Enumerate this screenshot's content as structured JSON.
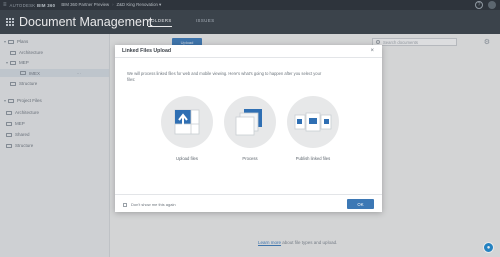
{
  "topbar": {
    "brand_prefix": "AUTODESK",
    "brand_product": "BIM 360",
    "project": "BIM 360 Partner Preview",
    "separator": "›",
    "location": "Z&D King Renovation ▾"
  },
  "header": {
    "title": "Document Management",
    "tabs": [
      {
        "label": "FOLDERS",
        "active": true
      },
      {
        "label": "ISSUES",
        "active": false
      }
    ]
  },
  "sidebar": {
    "sections": [
      {
        "label": "Plans"
      },
      {
        "label": "Project Files"
      }
    ],
    "items": [
      {
        "label": "Architecture"
      },
      {
        "label": "MEP"
      },
      {
        "label": "IMEX"
      },
      {
        "label": "Structure"
      },
      {
        "label": "Architecture"
      },
      {
        "label": "MEP"
      },
      {
        "label": "Shared"
      },
      {
        "label": "Structure"
      }
    ]
  },
  "main": {
    "upload_label": "Upload",
    "search_placeholder": "Search documents",
    "learn_link": "Learn more",
    "learn_rest": "about file types and upload."
  },
  "modal": {
    "title": "Linked Files Upload",
    "close_glyph": "×",
    "description": "We will process linked files for web and mobile viewing. Here's what's going to happen after you select your files:",
    "steps": [
      {
        "label": "Upload files"
      },
      {
        "label": "Process"
      },
      {
        "label": "Publish linked files"
      }
    ],
    "dont_show": "Don't show me this again",
    "ok_label": "OK"
  },
  "colors": {
    "accent": "#3c78b5",
    "topbar": "#2b3239",
    "header": "#39424b"
  }
}
